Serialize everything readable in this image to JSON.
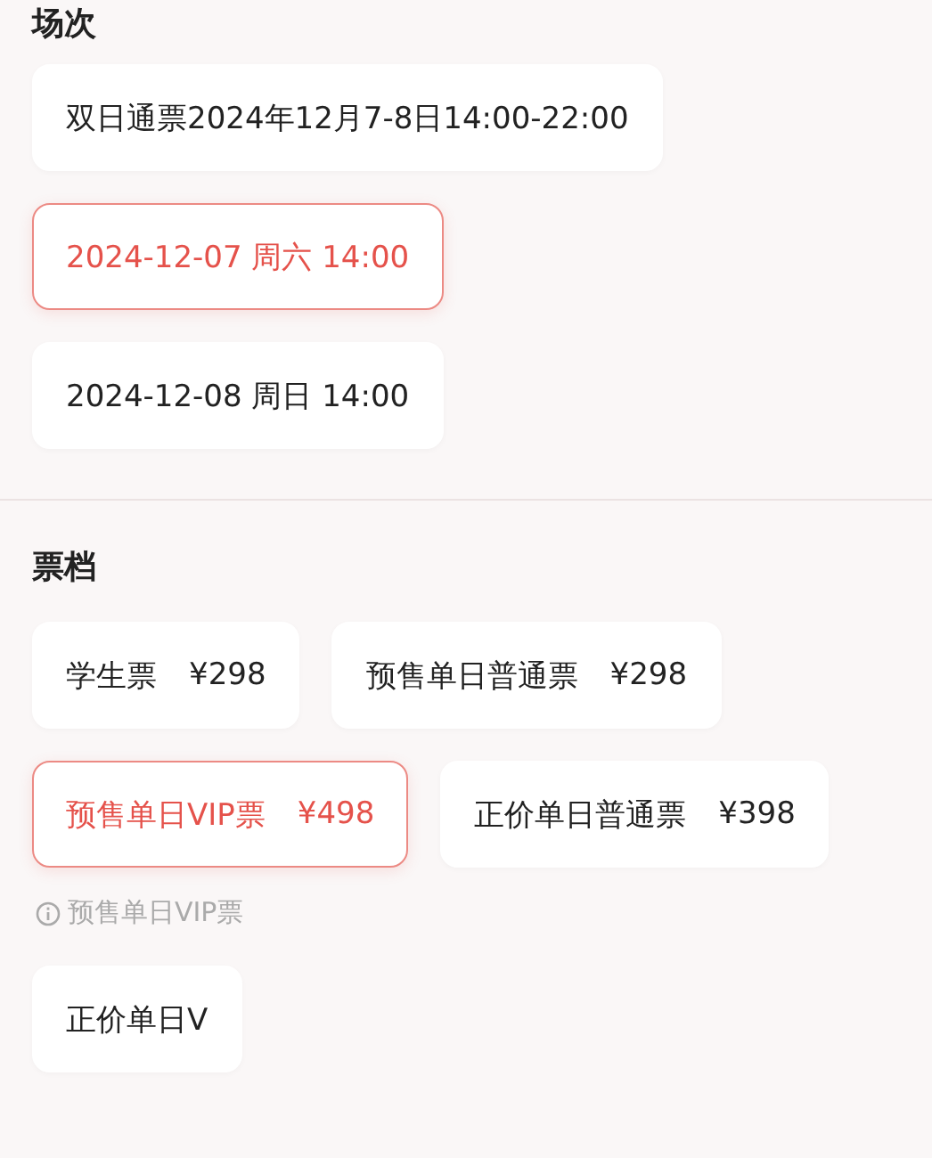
{
  "sessions": {
    "title": "场次",
    "options": [
      {
        "label": "双日通票2024年12月7-8日14:00-22:00",
        "selected": false
      },
      {
        "label": "2024-12-07 周六 14:00",
        "selected": true
      },
      {
        "label": "2024-12-08 周日 14:00",
        "selected": false
      }
    ]
  },
  "tiers": {
    "title": "票档",
    "options": [
      {
        "name": "学生票",
        "price": "¥298",
        "selected": false
      },
      {
        "name": "预售单日普通票",
        "price": "¥298",
        "selected": false
      },
      {
        "name": "预售单日VIP票",
        "price": "¥498",
        "selected": true
      },
      {
        "name": "正价单日普通票",
        "price": "¥398",
        "selected": false
      }
    ],
    "note": "预售单日VIP票",
    "more": [
      {
        "name": "正价单日V",
        "selected": false
      }
    ]
  }
}
